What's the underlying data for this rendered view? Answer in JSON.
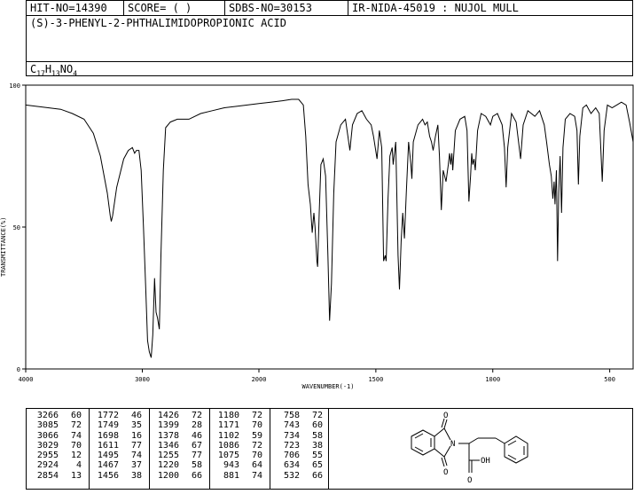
{
  "header": {
    "hit_no": "HIT-NO=14390",
    "score": "SCORE=  (    )",
    "sdbs_no": "SDBS-NO=30153",
    "ir_nida": "IR-NIDA-45019 : NUJOL MULL"
  },
  "compound": {
    "name": "(S)-3-PHENYL-2-PHTHALIMIDOPROPIONIC ACID",
    "formula_parts": [
      "C",
      "17",
      "H",
      "13",
      "NO",
      "4"
    ]
  },
  "chart_data": {
    "type": "line",
    "title": "",
    "xlabel": "WAVENUMBER(-1)",
    "ylabel": "TRANSMITTANCE(%)",
    "xlim": [
      4000,
      400
    ],
    "ylim": [
      0,
      100
    ],
    "x_ticks": [
      4000,
      3000,
      2000,
      1500,
      1000,
      500
    ],
    "y_ticks": [
      100,
      50,
      0
    ],
    "series": [
      {
        "name": "",
        "points": [
          [
            4000,
            93
          ],
          [
            3900,
            92.5
          ],
          [
            3800,
            92
          ],
          [
            3700,
            91.5
          ],
          [
            3600,
            90
          ],
          [
            3500,
            88
          ],
          [
            3420,
            83
          ],
          [
            3360,
            75
          ],
          [
            3300,
            62
          ],
          [
            3275,
            54
          ],
          [
            3266,
            52
          ],
          [
            3255,
            54
          ],
          [
            3220,
            64
          ],
          [
            3160,
            74
          ],
          [
            3120,
            77
          ],
          [
            3085,
            78
          ],
          [
            3066,
            76
          ],
          [
            3050,
            77
          ],
          [
            3029,
            77
          ],
          [
            3010,
            70
          ],
          [
            2990,
            50
          ],
          [
            2970,
            28
          ],
          [
            2955,
            10
          ],
          [
            2940,
            6
          ],
          [
            2924,
            4
          ],
          [
            2910,
            12
          ],
          [
            2895,
            32
          ],
          [
            2882,
            20
          ],
          [
            2870,
            18
          ],
          [
            2854,
            14
          ],
          [
            2840,
            40
          ],
          [
            2820,
            70
          ],
          [
            2800,
            85
          ],
          [
            2760,
            87
          ],
          [
            2700,
            88
          ],
          [
            2600,
            88
          ],
          [
            2500,
            90
          ],
          [
            2400,
            91
          ],
          [
            2300,
            92
          ],
          [
            2200,
            92.5
          ],
          [
            2100,
            93
          ],
          [
            2000,
            93.5
          ],
          [
            1950,
            94
          ],
          [
            1900,
            94.5
          ],
          [
            1860,
            95
          ],
          [
            1830,
            95
          ],
          [
            1810,
            93
          ],
          [
            1800,
            82
          ],
          [
            1790,
            65
          ],
          [
            1780,
            58
          ],
          [
            1772,
            48
          ],
          [
            1765,
            55
          ],
          [
            1760,
            50
          ],
          [
            1752,
            38
          ],
          [
            1749,
            36
          ],
          [
            1742,
            55
          ],
          [
            1735,
            72
          ],
          [
            1725,
            74
          ],
          [
            1715,
            68
          ],
          [
            1705,
            40
          ],
          [
            1698,
            17
          ],
          [
            1690,
            30
          ],
          [
            1680,
            62
          ],
          [
            1670,
            80
          ],
          [
            1650,
            86
          ],
          [
            1630,
            88
          ],
          [
            1611,
            77
          ],
          [
            1600,
            86
          ],
          [
            1580,
            90
          ],
          [
            1560,
            91
          ],
          [
            1540,
            88
          ],
          [
            1520,
            86
          ],
          [
            1510,
            82
          ],
          [
            1495,
            74
          ],
          [
            1485,
            84
          ],
          [
            1475,
            78
          ],
          [
            1467,
            38
          ],
          [
            1460,
            40
          ],
          [
            1456,
            38
          ],
          [
            1448,
            60
          ],
          [
            1440,
            75
          ],
          [
            1430,
            78
          ],
          [
            1426,
            72
          ],
          [
            1415,
            80
          ],
          [
            1405,
            40
          ],
          [
            1399,
            28
          ],
          [
            1392,
            45
          ],
          [
            1385,
            55
          ],
          [
            1378,
            46
          ],
          [
            1370,
            62
          ],
          [
            1360,
            80
          ],
          [
            1350,
            72
          ],
          [
            1346,
            67
          ],
          [
            1340,
            80
          ],
          [
            1320,
            86
          ],
          [
            1300,
            88
          ],
          [
            1290,
            86
          ],
          [
            1280,
            87
          ],
          [
            1270,
            82
          ],
          [
            1262,
            80
          ],
          [
            1255,
            77
          ],
          [
            1245,
            82
          ],
          [
            1235,
            86
          ],
          [
            1228,
            75
          ],
          [
            1220,
            56
          ],
          [
            1212,
            70
          ],
          [
            1200,
            66
          ],
          [
            1190,
            72
          ],
          [
            1185,
            76
          ],
          [
            1180,
            72
          ],
          [
            1175,
            76
          ],
          [
            1171,
            70
          ],
          [
            1160,
            84
          ],
          [
            1140,
            88
          ],
          [
            1120,
            89
          ],
          [
            1110,
            84
          ],
          [
            1102,
            59
          ],
          [
            1095,
            68
          ],
          [
            1090,
            76
          ],
          [
            1086,
            72
          ],
          [
            1080,
            74
          ],
          [
            1075,
            70
          ],
          [
            1065,
            84
          ],
          [
            1050,
            90
          ],
          [
            1030,
            89
          ],
          [
            1010,
            86
          ],
          [
            1000,
            89
          ],
          [
            980,
            90
          ],
          [
            960,
            86
          ],
          [
            950,
            78
          ],
          [
            943,
            64
          ],
          [
            936,
            78
          ],
          [
            920,
            90
          ],
          [
            900,
            87
          ],
          [
            890,
            80
          ],
          [
            881,
            74
          ],
          [
            870,
            86
          ],
          [
            850,
            91
          ],
          [
            820,
            89
          ],
          [
            800,
            91
          ],
          [
            780,
            86
          ],
          [
            770,
            80
          ],
          [
            758,
            72
          ],
          [
            750,
            68
          ],
          [
            743,
            60
          ],
          [
            738,
            66
          ],
          [
            734,
            58
          ],
          [
            728,
            70
          ],
          [
            723,
            38
          ],
          [
            718,
            62
          ],
          [
            712,
            75
          ],
          [
            706,
            55
          ],
          [
            700,
            78
          ],
          [
            690,
            88
          ],
          [
            670,
            90
          ],
          [
            650,
            89
          ],
          [
            640,
            84
          ],
          [
            634,
            65
          ],
          [
            628,
            82
          ],
          [
            615,
            92
          ],
          [
            600,
            93
          ],
          [
            580,
            90
          ],
          [
            560,
            92
          ],
          [
            545,
            90
          ],
          [
            532,
            66
          ],
          [
            524,
            84
          ],
          [
            510,
            93
          ],
          [
            490,
            92
          ],
          [
            470,
            93
          ],
          [
            450,
            94
          ],
          [
            430,
            93
          ],
          [
            415,
            87
          ],
          [
            400,
            80
          ]
        ]
      }
    ]
  },
  "peak_table": {
    "columns": [
      [
        [
          "3266",
          "60"
        ],
        [
          "3085",
          "72"
        ],
        [
          "3066",
          "74"
        ],
        [
          "3029",
          "70"
        ],
        [
          "2955",
          "12"
        ],
        [
          "2924",
          "4"
        ],
        [
          "2854",
          "13"
        ]
      ],
      [
        [
          "1772",
          "46"
        ],
        [
          "1749",
          "35"
        ],
        [
          "1698",
          "16"
        ],
        [
          "1611",
          "77"
        ],
        [
          "1495",
          "74"
        ],
        [
          "1467",
          "37"
        ],
        [
          "1456",
          "38"
        ]
      ],
      [
        [
          "1426",
          "72"
        ],
        [
          "1399",
          "28"
        ],
        [
          "1378",
          "46"
        ],
        [
          "1346",
          "67"
        ],
        [
          "1255",
          "77"
        ],
        [
          "1220",
          "58"
        ],
        [
          "1200",
          "66"
        ]
      ],
      [
        [
          "1180",
          "72"
        ],
        [
          "1171",
          "70"
        ],
        [
          "1102",
          "59"
        ],
        [
          "1086",
          "72"
        ],
        [
          "1075",
          "70"
        ],
        [
          "943",
          "64"
        ],
        [
          "881",
          "74"
        ]
      ],
      [
        [
          "758",
          "72"
        ],
        [
          "743",
          "60"
        ],
        [
          "734",
          "58"
        ],
        [
          "723",
          "38"
        ],
        [
          "706",
          "55"
        ],
        [
          "634",
          "65"
        ],
        [
          "532",
          "66"
        ]
      ]
    ]
  },
  "structure": {
    "labels": {
      "oxygen_top": "O",
      "oxygen_bottom": "O",
      "nitrogen": "N",
      "acid_oxygen": "O",
      "acid_hydroxyl": "OH"
    }
  }
}
